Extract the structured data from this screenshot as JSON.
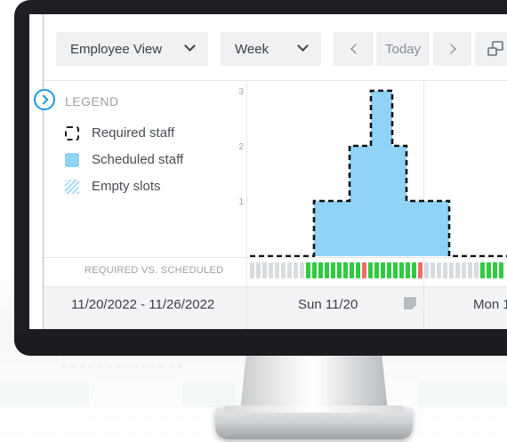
{
  "toolbar": {
    "view_select": "Employee View",
    "period_select": "Week",
    "prev_label": "<",
    "today_label": "Today",
    "next_label": ">"
  },
  "legend": {
    "title": "LEGEND",
    "items": [
      {
        "label": "Required staff"
      },
      {
        "label": "Scheduled staff"
      },
      {
        "label": "Empty slots"
      }
    ]
  },
  "chart_data": {
    "type": "area",
    "yticks": [
      1,
      2,
      3
    ],
    "ylim": [
      0,
      3
    ],
    "x": [
      0,
      1,
      2,
      3,
      4,
      5,
      6,
      7,
      8,
      9,
      10,
      11,
      12,
      13,
      14,
      15,
      16,
      17,
      18,
      19,
      20,
      21,
      22,
      23,
      24,
      25,
      26,
      27,
      28,
      29,
      30,
      31,
      32,
      33,
      34,
      35,
      36,
      37
    ],
    "series": [
      {
        "values": [
          0,
          0,
          0,
          0,
          0,
          0,
          0,
          0,
          0,
          1,
          1,
          1,
          1,
          1,
          2,
          2,
          2,
          3,
          3,
          3,
          2,
          2,
          1,
          1,
          1,
          1,
          1,
          1,
          0,
          0,
          0,
          0,
          0,
          0,
          0,
          0,
          0,
          1
        ]
      },
      {
        "values": [
          0,
          0,
          0,
          0,
          0,
          0,
          0,
          0,
          0,
          1,
          1,
          1,
          1,
          1,
          2,
          2,
          2,
          3,
          3,
          3,
          2,
          2,
          1,
          1,
          1,
          1,
          1,
          1,
          0,
          0,
          0,
          0,
          0,
          0,
          0,
          0,
          0,
          1
        ]
      }
    ]
  },
  "coverage": {
    "label": "REQUIRED VS. SCHEDULED",
    "status": [
      "none",
      "none",
      "none",
      "none",
      "none",
      "none",
      "none",
      "none",
      "none",
      "ok",
      "ok",
      "ok",
      "ok",
      "ok",
      "ok",
      "ok",
      "ok",
      "ok",
      "over",
      "ok",
      "ok",
      "ok",
      "ok",
      "ok",
      "ok",
      "ok",
      "ok",
      "over",
      "none",
      "none",
      "none",
      "none",
      "none",
      "none",
      "none",
      "none",
      "none",
      "ok",
      "ok",
      "ok",
      "ok"
    ],
    "colors": {
      "none": "#d9dcdf",
      "ok": "#2fcb3f",
      "over": "#f06b6b"
    }
  },
  "footer": {
    "date_range": "11/20/2022 - 11/26/2022",
    "day1": "Sun 11/20",
    "day2": "Mon 1"
  },
  "colors": {
    "accent": "#1a9bd7",
    "scheduled": "#8fd3f6"
  }
}
